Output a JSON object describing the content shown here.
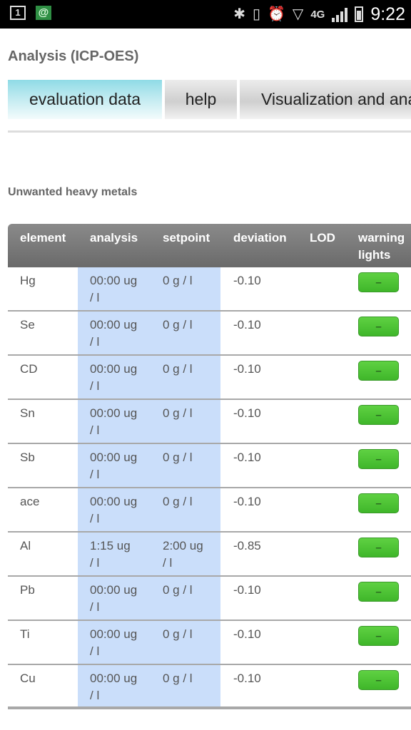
{
  "status_bar": {
    "notif_box": "1",
    "notif_at": "@",
    "network": "4G",
    "time": "9:22"
  },
  "page": {
    "title": "Analysis (ICP-OES)",
    "section_title": "Unwanted heavy metals"
  },
  "tabs": [
    {
      "label": "evaluation data"
    },
    {
      "label": "help"
    },
    {
      "label": "Visualization and analysis"
    }
  ],
  "table": {
    "headers": [
      "element",
      "analysis",
      "setpoint",
      "deviation",
      "LOD",
      "warning lights"
    ],
    "header_wrapped": {
      "warning_line1": "warning",
      "warning_line2": "lights"
    },
    "light_label": "–",
    "rows": [
      {
        "element": "Hg",
        "analysis_1": "00:00 ug",
        "analysis_2": "/ l",
        "setpoint_1": "0 g / l",
        "setpoint_2": "",
        "deviation": "-0.10",
        "lod": ""
      },
      {
        "element": "Se",
        "analysis_1": "00:00 ug",
        "analysis_2": "/ l",
        "setpoint_1": "0 g / l",
        "setpoint_2": "",
        "deviation": "-0.10",
        "lod": ""
      },
      {
        "element": "CD",
        "analysis_1": "00:00 ug",
        "analysis_2": "/ l",
        "setpoint_1": "0 g / l",
        "setpoint_2": "",
        "deviation": "-0.10",
        "lod": ""
      },
      {
        "element": "Sn",
        "analysis_1": "00:00 ug",
        "analysis_2": "/ l",
        "setpoint_1": "0 g / l",
        "setpoint_2": "",
        "deviation": "-0.10",
        "lod": ""
      },
      {
        "element": "Sb",
        "analysis_1": "00:00 ug",
        "analysis_2": "/ l",
        "setpoint_1": "0 g / l",
        "setpoint_2": "",
        "deviation": "-0.10",
        "lod": ""
      },
      {
        "element": "ace",
        "analysis_1": "00:00 ug",
        "analysis_2": "/ l",
        "setpoint_1": "0 g / l",
        "setpoint_2": "",
        "deviation": "-0.10",
        "lod": ""
      },
      {
        "element": "Al",
        "analysis_1": "1:15 ug",
        "analysis_2": "/ l",
        "setpoint_1": "2:00 ug",
        "setpoint_2": "/ l",
        "deviation": "-0.85",
        "lod": ""
      },
      {
        "element": "Pb",
        "analysis_1": "00:00 ug",
        "analysis_2": "/ l",
        "setpoint_1": "0 g / l",
        "setpoint_2": "",
        "deviation": "-0.10",
        "lod": ""
      },
      {
        "element": "Ti",
        "analysis_1": "00:00 ug",
        "analysis_2": "/ l",
        "setpoint_1": "0 g / l",
        "setpoint_2": "",
        "deviation": "-0.10",
        "lod": ""
      },
      {
        "element": "Cu",
        "analysis_1": "00:00 ug",
        "analysis_2": "/ l",
        "setpoint_1": "0 g / l",
        "setpoint_2": "",
        "deviation": "-0.10",
        "lod": ""
      }
    ]
  },
  "colors": {
    "highlight_column": "#cadefa",
    "active_tab": "#8fdbe6",
    "warning_light_ok": "#4fc236"
  }
}
